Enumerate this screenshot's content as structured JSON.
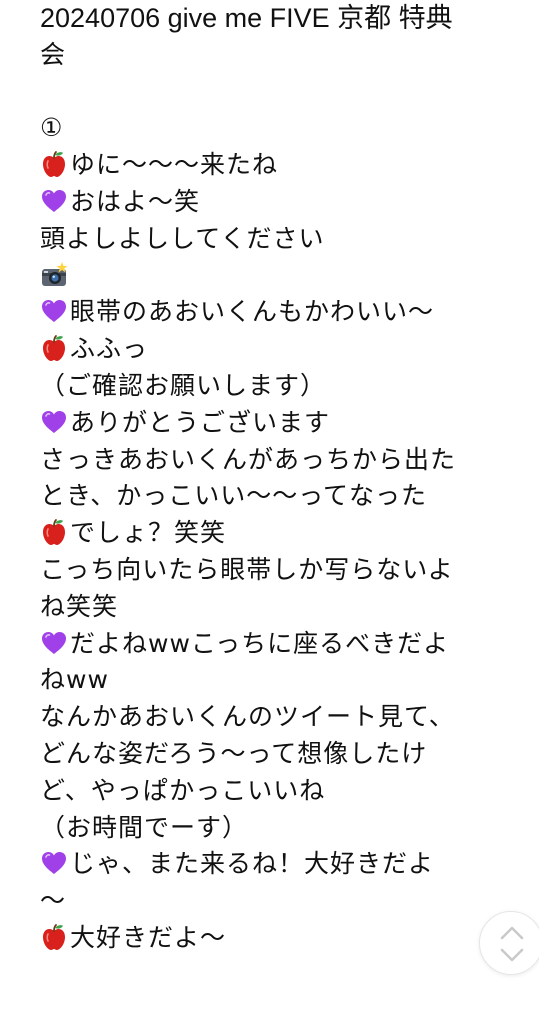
{
  "post": {
    "title_line1": "20240706 give me FIVE 京都 特典",
    "title_line2": "会",
    "section_mark": "①",
    "lines": [
      {
        "icon": "apple",
        "text": "ゆに～～～来たね"
      },
      {
        "icon": "purple-heart",
        "text": "おはよ～笑"
      },
      {
        "icon": "",
        "text": "頭よしよししてください"
      },
      {
        "icon": "camera-flash",
        "text": ""
      },
      {
        "icon": "purple-heart",
        "text": "眼帯のあおいくんもかわいい～"
      },
      {
        "icon": "apple",
        "text": "ふふっ"
      },
      {
        "icon": "",
        "text": "（ご確認お願いします）"
      },
      {
        "icon": "purple-heart",
        "text": "ありがとうございます"
      },
      {
        "icon": "",
        "text": "さっきあおいくんがあっちから出た"
      },
      {
        "icon": "",
        "text": "とき、かっこいい～～ってなった"
      },
      {
        "icon": "apple",
        "text": "でしょ？笑笑"
      },
      {
        "icon": "",
        "text": "こっち向いたら眼帯しか写らないよ"
      },
      {
        "icon": "",
        "text": "ね笑笑"
      },
      {
        "icon": "purple-heart",
        "text": "だよねwwこっちに座るべきだよ"
      },
      {
        "icon": "",
        "text": "ねww"
      },
      {
        "icon": "",
        "text": "なんかあおいくんのツイート見て、"
      },
      {
        "icon": "",
        "text": "どんな姿だろう～って想像したけ"
      },
      {
        "icon": "",
        "text": "ど、やっぱかっこいいね"
      },
      {
        "icon": "",
        "text": "（お時間でーす）"
      },
      {
        "icon": "purple-heart",
        "text": "じゃ、また来るね！大好きだよ"
      },
      {
        "icon": "",
        "text": "～"
      },
      {
        "icon": "apple",
        "text": "大好きだよ～"
      }
    ]
  },
  "scroll_button": {
    "icon": "chevron-up-down-icon"
  },
  "colors": {
    "text": "#111111",
    "background": "#ffffff",
    "apple_red": "#d8201c",
    "heart_purple": "#a040e8",
    "button_icon": "#c9c9c9"
  }
}
